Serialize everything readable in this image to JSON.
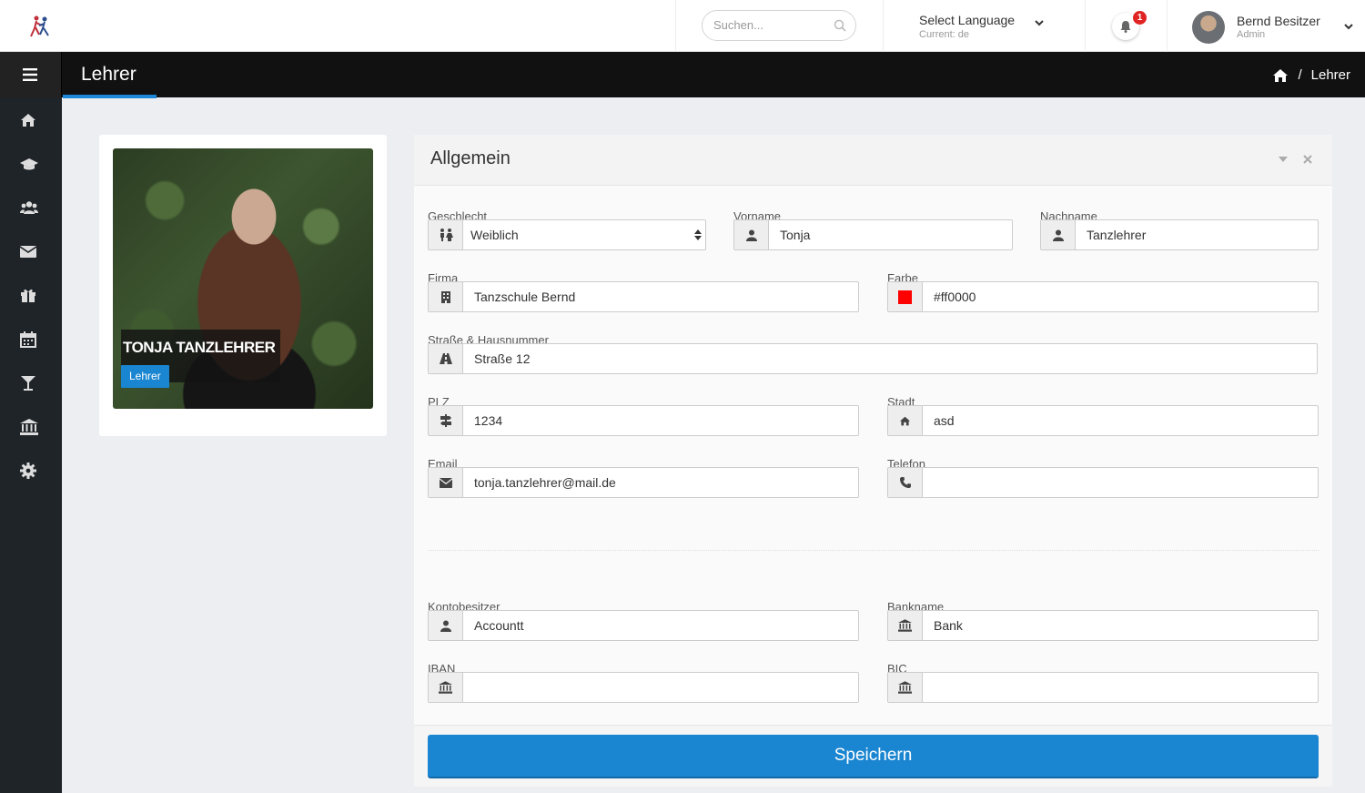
{
  "header": {
    "search_placeholder": "Suchen...",
    "language_title": "Select Language",
    "language_current": "Current: de",
    "notification_count": "1",
    "user_name": "Bernd Besitzer",
    "user_role": "Admin"
  },
  "subbar": {
    "page_title": "Lehrer",
    "breadcrumb_sep": "/",
    "breadcrumb_current": "Lehrer"
  },
  "sidebar": {
    "icons": [
      "home-icon",
      "graduation-cap-icon",
      "users-icon",
      "envelope-icon",
      "gift-icon",
      "calendar-icon",
      "cocktail-icon",
      "bank-icon",
      "gear-icon"
    ]
  },
  "profile": {
    "name": "TONJA TANZLEHRER",
    "role": "Lehrer"
  },
  "form": {
    "title": "Allgemein",
    "geschlecht": {
      "label": "Geschlecht",
      "value": "Weiblich"
    },
    "vorname": {
      "label": "Vorname",
      "value": "Tonja"
    },
    "nachname": {
      "label": "Nachname",
      "value": "Tanzlehrer"
    },
    "firma": {
      "label": "Firma",
      "value": "Tanzschule Bernd"
    },
    "farbe": {
      "label": "Farbe",
      "value": "#ff0000",
      "color": "#ff0000"
    },
    "strasse": {
      "label": "Straße & Hausnummer",
      "value": "Straße 12"
    },
    "plz": {
      "label": "PLZ",
      "value": "1234"
    },
    "stadt": {
      "label": "Stadt",
      "value": "asd"
    },
    "email": {
      "label": "Email",
      "value": "tonja.tanzlehrer@mail.de"
    },
    "telefon": {
      "label": "Telefon",
      "value": ""
    },
    "kontobesitzer": {
      "label": "Kontobesitzer",
      "value": "Accountt"
    },
    "bankname": {
      "label": "Bankname",
      "value": "Bank"
    },
    "iban": {
      "label": "IBAN",
      "value": ""
    },
    "bic": {
      "label": "BIC",
      "value": ""
    },
    "save_label": "Speichern"
  },
  "colors": {
    "accent": "#1a85d0",
    "sidebar": "#1f2429",
    "subbar": "#111111"
  }
}
